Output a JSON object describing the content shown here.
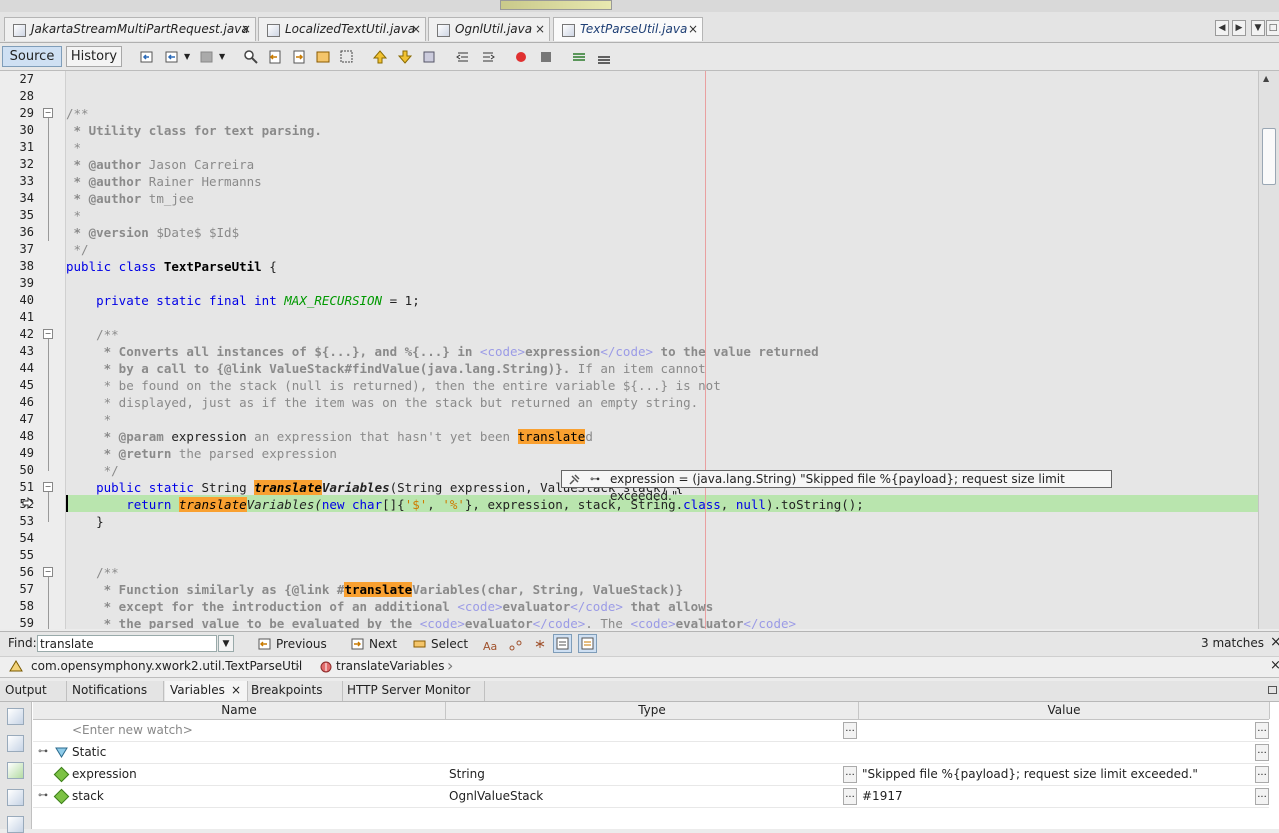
{
  "tabs": [
    {
      "label": "JakartaStreamMultiPartRequest.java",
      "active": false
    },
    {
      "label": "LocalizedTextUtil.java",
      "active": false
    },
    {
      "label": "OgnlUtil.java",
      "active": false
    },
    {
      "label": "TextParseUtil.java",
      "active": true
    }
  ],
  "tab_close": "×",
  "editor_toolbar": {
    "source_label": "Source",
    "history_label": "History"
  },
  "editor": {
    "line_numbers": [
      "27",
      "28",
      "29",
      "30",
      "31",
      "32",
      "33",
      "34",
      "35",
      "36",
      "37",
      "38",
      "39",
      "40",
      "41",
      "42",
      "43",
      "44",
      "45",
      "46",
      "47",
      "48",
      "49",
      "50",
      "51",
      "52",
      "53",
      "54",
      "55",
      "56",
      "57",
      "58",
      "59"
    ],
    "code": {
      "l29": "/**",
      "l30": " * Utility class for text parsing.",
      "l31": " *",
      "l32a": " * @author",
      "l32b": " Jason Carreira",
      "l33a": " * @author",
      "l33b": " Rainer Hermanns",
      "l34a": " * @author",
      "l34b": " tm_jee",
      "l35": " *",
      "l36a": " * @version",
      "l36b": " $Date$ $Id$",
      "l37": " */",
      "l38a": "public class ",
      "l38b": "TextParseUtil",
      "l38c": " {",
      "l40a": "    private static final int ",
      "l40b": "MAX_RECURSION",
      "l40c": " = 1;",
      "l42": "    /**",
      "l43a": "     * Converts all instances of ${...}, and %{...} in ",
      "l43b": "<code>",
      "l43c": "expression",
      "l43d": "</code>",
      "l43e": " to the value returned",
      "l44a": "     * by a call to {@link ValueStack#findValue(java.lang.String)}.",
      "l44b": " If an item cannot",
      "l45": "     * be found on the stack (null is returned), then the entire variable ${...} is not",
      "l46": "     * displayed, just as if the item was on the stack but returned an empty string.",
      "l47": "     *",
      "l48a": "     * @param",
      "l48b": " expression",
      "l48c": " an expression that hasn't yet been ",
      "l48d": "translate",
      "l48e": "d",
      "l49a": "     * @return",
      "l49b": " the parsed expression",
      "l50": "     */",
      "l51a": "    public static ",
      "l51b": "String ",
      "l51c": "translate",
      "l51d": "Variables",
      "l51e": "(String expression, ValueStack stack) {",
      "l52a": "        return ",
      "l52b": "translate",
      "l52c": "Variables(",
      "l52d": "new ",
      "l52e": "char",
      "l52f": "[]{",
      "l52g": "'$'",
      "l52h": ", ",
      "l52i": "'%'",
      "l52j": "}, expression, stack, String.",
      "l52k": "class",
      "l52l": ", ",
      "l52m": "null",
      "l52n": ").toString();",
      "l53": "    }",
      "l56": "    /**",
      "l57a": "     * Function similarly as {@link #",
      "l57b": "translate",
      "l57c": "Variables(char, String, ValueStack)}",
      "l58a": "     * except for the introduction of an additional ",
      "l58b": "<code>",
      "l58c": "evaluator",
      "l58d": "</code>",
      "l58e": " that allows",
      "l59a": "     * the parsed value to be evaluated by the ",
      "l59b": "<code>",
      "l59c": "evaluator",
      "l59d": "</code>",
      "l59e": ". The ",
      "l59f": "<code>",
      "l59g": "evaluator",
      "l59h": "</code>"
    },
    "tooltip": "expression = (java.lang.String) \"Skipped file %{payload}; request size limit exceeded.\""
  },
  "findbar": {
    "label": "Find:",
    "value": "translate",
    "previous": "Previous",
    "next": "Next",
    "select": "Select",
    "matches": "3 matches",
    "close": "×"
  },
  "breadcrumb": {
    "class_path": "com.opensymphony.xwork2.util.TextParseUtil",
    "method": "translateVariables",
    "close": "×"
  },
  "bottom_tabs": [
    "Output",
    "Notifications",
    "Variables",
    "Breakpoints",
    "HTTP Server Monitor"
  ],
  "variables": {
    "headers": {
      "name": "Name",
      "type": "Type",
      "value": "Value"
    },
    "rows": [
      {
        "name": "<Enter new watch>",
        "type": "",
        "value": ""
      },
      {
        "name": "Static",
        "type": "",
        "value": ""
      },
      {
        "name": "expression",
        "type": "String",
        "value": "\"Skipped file %{payload}; request size limit exceeded.\""
      },
      {
        "name": "stack",
        "type": "OgnlValueStack",
        "value": "#1917"
      }
    ],
    "dots": "..."
  },
  "colors": {
    "search_highlight": "#f9a030",
    "current_line": "#b9e5ae",
    "keyword": "#0000e6",
    "comment": "#8a8a8a"
  }
}
